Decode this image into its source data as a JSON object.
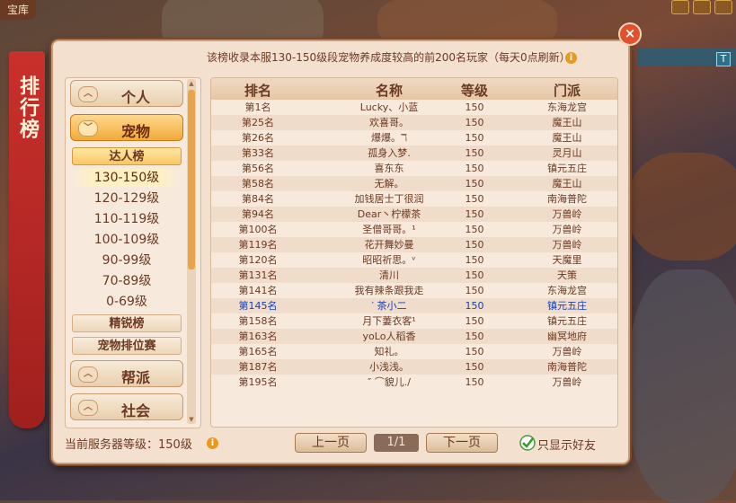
{
  "top_tag": "宝库",
  "t_chip": "T",
  "close_label": "×",
  "banner_title": "排行榜",
  "notice": "该榜收录本服130-150级段宠物养成度较高的前200名玩家（每天0点刷新）",
  "info_glyph": "i",
  "categories": {
    "personal": "个人",
    "pet": "宠物",
    "guild": "帮派",
    "social": "社会"
  },
  "pet_sub": {
    "expert": "达人榜",
    "elite": "精锐榜",
    "tournament": "宠物排位赛"
  },
  "levels": [
    "130-150级",
    "120-129级",
    "110-119级",
    "100-109级",
    "90-99级",
    "70-89级",
    "0-69级"
  ],
  "table": {
    "headers": [
      "排名",
      "名称",
      "等级",
      "门派"
    ],
    "rows": [
      [
        "第1名",
        "Lucky、小蓝",
        "150",
        "东海龙宫"
      ],
      [
        "第25名",
        "欢喜哥。",
        "150",
        "魔王山"
      ],
      [
        "第26名",
        "爆爆。ℸ",
        "150",
        "魔王山"
      ],
      [
        "第33名",
        "孤身入梦.",
        "150",
        "灵月山"
      ],
      [
        "第56名",
        "喜东东",
        "150",
        "镇元五庄"
      ],
      [
        "第58名",
        "无解。",
        "150",
        "魔王山"
      ],
      [
        "第84名",
        "加钱居士丁很润",
        "150",
        "南海普陀"
      ],
      [
        "第94名",
        "Dear丶柠檬茶",
        "150",
        "万兽岭"
      ],
      [
        "第100名",
        "圣僧哥哥。¹",
        "150",
        "万兽岭"
      ],
      [
        "第119名",
        "花开舞妙曼",
        "150",
        "万兽岭"
      ],
      [
        "第120名",
        "昭昭祈思。ᵛ",
        "150",
        "天魔里"
      ],
      [
        "第131名",
        "清川",
        "150",
        "天策"
      ],
      [
        "第141名",
        "我有辣条跟我走",
        "150",
        "东海龙宫"
      ],
      [
        "第145名",
        "′ 茶小二",
        "150",
        "镇元五庄"
      ],
      [
        "第158名",
        "月下萋衣客¹",
        "150",
        "镇元五庄"
      ],
      [
        "第163名",
        "yoLo人稻香",
        "150",
        "幽冥地府"
      ],
      [
        "第165名",
        "知礼。",
        "150",
        "万兽岭"
      ],
      [
        "第187名",
        "小浅浅。",
        "150",
        "南海普陀"
      ],
      [
        "第195名",
        "″ ⌒貌儿./",
        "150",
        "万兽岭"
      ]
    ],
    "highlight_row": 13
  },
  "footer": {
    "server_level": "当前服务器等级：150级",
    "prev": "上一页",
    "page": "1/1",
    "next": "下一页",
    "friends_only": "只显示好友"
  },
  "colors": {
    "accent": "#f2a93a",
    "highlight_text": "#1a3fb0",
    "banner_red": "#c9302c"
  }
}
